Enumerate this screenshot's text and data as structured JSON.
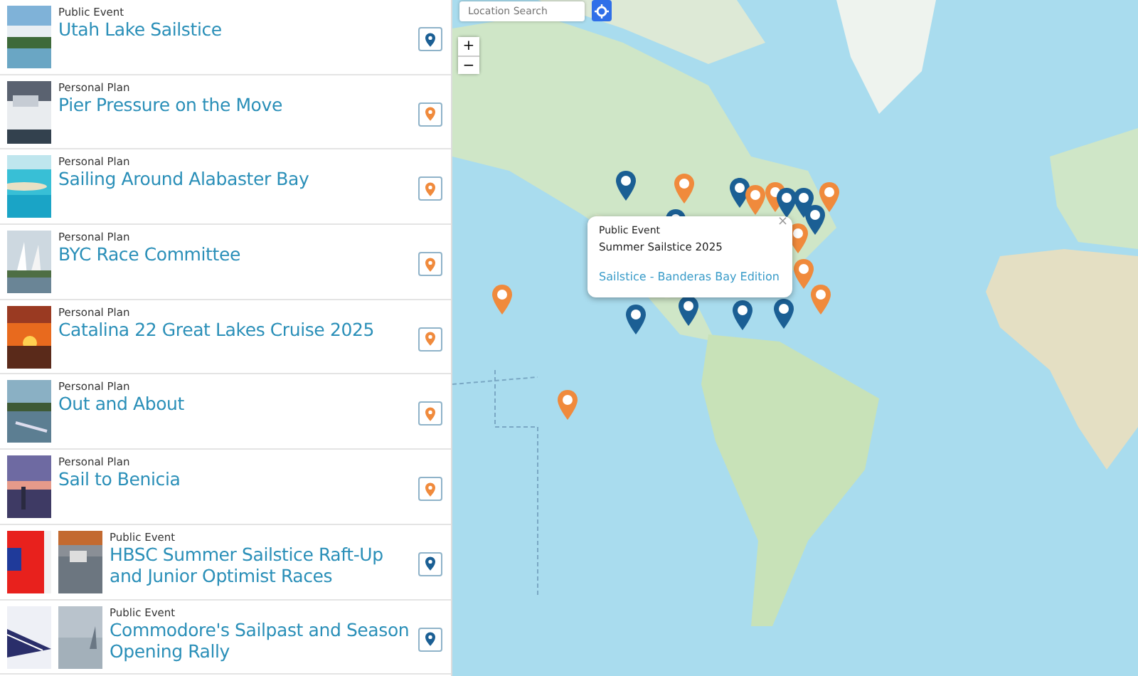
{
  "plans": [
    {
      "type": "Public Event",
      "title": "Utah Lake Sailstice",
      "color": "#1b5f94"
    },
    {
      "type": "Personal Plan",
      "title": "Pier Pressure on the Move",
      "color": "#f08a3c"
    },
    {
      "type": "Personal Plan",
      "title": "Sailing Around Alabaster Bay",
      "color": "#f08a3c"
    },
    {
      "type": "Personal Plan",
      "title": "BYC Race Committee",
      "color": "#f08a3c"
    },
    {
      "type": "Personal Plan",
      "title": "Catalina 22 Great Lakes Cruise 2025",
      "color": "#f08a3c"
    },
    {
      "type": "Personal Plan",
      "title": "Out and About",
      "color": "#f08a3c"
    },
    {
      "type": "Personal Plan",
      "title": "Sail to Benicia",
      "color": "#f08a3c"
    },
    {
      "type": "Public Event",
      "title": "HBSC Summer Sailstice Raft-Up and Junior Optimist Races",
      "color": "#1b5f94"
    },
    {
      "type": "Public Event",
      "title": "Commodore's Sailpast and Season Opening Rally",
      "color": "#1b5f94"
    }
  ],
  "map": {
    "search": {
      "placeholder": "Location Search"
    },
    "zoom_in": "+",
    "zoom_out": "−",
    "markers": [
      {
        "color": "#1b5f94"
      },
      {
        "color": "#f08a3c"
      },
      {
        "color": "#1b5f94"
      },
      {
        "color": "#f08a3c"
      },
      {
        "color": "#1b5f94"
      },
      {
        "color": "#f08a3c"
      },
      {
        "color": "#1b5f94"
      },
      {
        "color": "#f08a3c"
      },
      {
        "color": "#1b5f94"
      },
      {
        "color": "#f08a3c"
      },
      {
        "color": "#1b5f94"
      },
      {
        "color": "#1b5f94"
      },
      {
        "color": "#1b5f94"
      },
      {
        "color": "#1b5f94"
      },
      {
        "color": "#f08a3c"
      },
      {
        "color": "#f08a3c"
      },
      {
        "color": "#f08a3c"
      },
      {
        "color": "#1b5f94"
      },
      {
        "color": "#f08a3c"
      }
    ],
    "popup": {
      "type": "Public Event",
      "event": "Summer Sailstice 2025",
      "link": "Sailstice - Banderas Bay Edition",
      "close": "×"
    }
  }
}
